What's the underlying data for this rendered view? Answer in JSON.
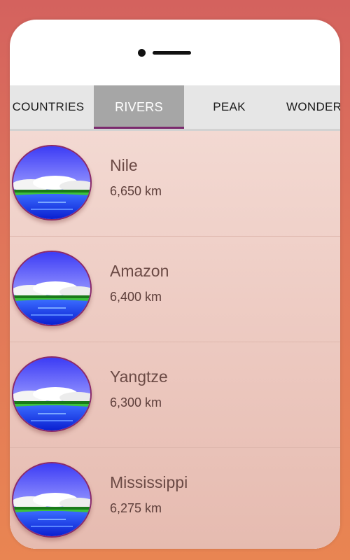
{
  "tabs": [
    {
      "label": "COUNTRIES",
      "active": false
    },
    {
      "label": "RIVERS",
      "active": true
    },
    {
      "label": "PEAK",
      "active": false
    },
    {
      "label": "WONDERS",
      "active": false
    }
  ],
  "rivers": [
    {
      "name": "Nile",
      "length": "6,650 km"
    },
    {
      "name": "Amazon",
      "length": "6,400 km"
    },
    {
      "name": "Yangtze",
      "length": "6,300 km"
    },
    {
      "name": "Mississippi",
      "length": "6,275 km"
    }
  ],
  "colors": {
    "background": "#e07a58",
    "tab_active": "#a6a6a6",
    "tab_indicator": "#7b2a6e",
    "list_bg": "#efd0c8",
    "text": "#6b4a45"
  },
  "icons": {
    "list_thumbnail": "river-landscape-icon"
  }
}
